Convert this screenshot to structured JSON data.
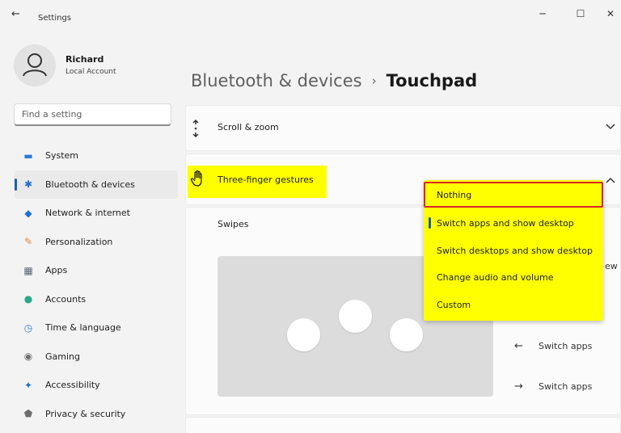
{
  "window": {
    "title": "Settings",
    "back_glyph": "←",
    "minimize_glyph": "─",
    "maximize_glyph": "☐",
    "close_glyph": "✕"
  },
  "profile": {
    "name": "Richard",
    "account_type": "Local Account"
  },
  "search": {
    "placeholder": "Find a setting"
  },
  "sidebar": {
    "items": [
      {
        "label": "System",
        "icon": "monitor-icon",
        "glyph": "▬",
        "color": "#2b7bd4",
        "active": false
      },
      {
        "label": "Bluetooth & devices",
        "icon": "bluetooth-icon",
        "glyph": "✱",
        "color": "#1a6fd0",
        "active": true
      },
      {
        "label": "Network & internet",
        "icon": "wifi-icon",
        "glyph": "◆",
        "color": "#1a6fd0",
        "active": false
      },
      {
        "label": "Personalization",
        "icon": "brush-icon",
        "glyph": "✎",
        "color": "#e2803b",
        "active": false
      },
      {
        "label": "Apps",
        "icon": "apps-icon",
        "glyph": "▦",
        "color": "#5a6470",
        "active": false
      },
      {
        "label": "Accounts",
        "icon": "person-icon",
        "glyph": "●",
        "color": "#2aa889",
        "active": false
      },
      {
        "label": "Time & language",
        "icon": "globe-clock-icon",
        "glyph": "◷",
        "color": "#2b7bd4",
        "active": false
      },
      {
        "label": "Gaming",
        "icon": "gamepad-icon",
        "glyph": "◉",
        "color": "#6d6d6d",
        "active": false
      },
      {
        "label": "Accessibility",
        "icon": "accessibility-icon",
        "glyph": "✦",
        "color": "#1a6fd0",
        "active": false
      },
      {
        "label": "Privacy & security",
        "icon": "shield-icon",
        "glyph": "⬟",
        "color": "#6d6d6d",
        "active": false
      }
    ]
  },
  "breadcrumb": {
    "parent": "Bluetooth & devices",
    "separator": "›",
    "current": "Touchpad"
  },
  "sections": {
    "scroll_zoom": {
      "label": "Scroll & zoom"
    },
    "three_finger": {
      "label": "Three-finger gestures"
    }
  },
  "swipes": {
    "label": "Swipes",
    "dropdown": {
      "options": [
        {
          "label": "Nothing"
        },
        {
          "label": "Switch apps and show desktop"
        },
        {
          "label": "Switch desktops and show desktop"
        },
        {
          "label": "Change audio and volume"
        },
        {
          "label": "Custom"
        }
      ]
    },
    "partial_text": "ew"
  },
  "gesture_preview": {
    "left_label": "Switch apps",
    "left_arrow": "←",
    "right_label": "Switch apps",
    "right_arrow": "→"
  },
  "colors": {
    "accent": "#1a5fb4",
    "highlight": "#ffff00",
    "callout_border": "#d7262b"
  }
}
